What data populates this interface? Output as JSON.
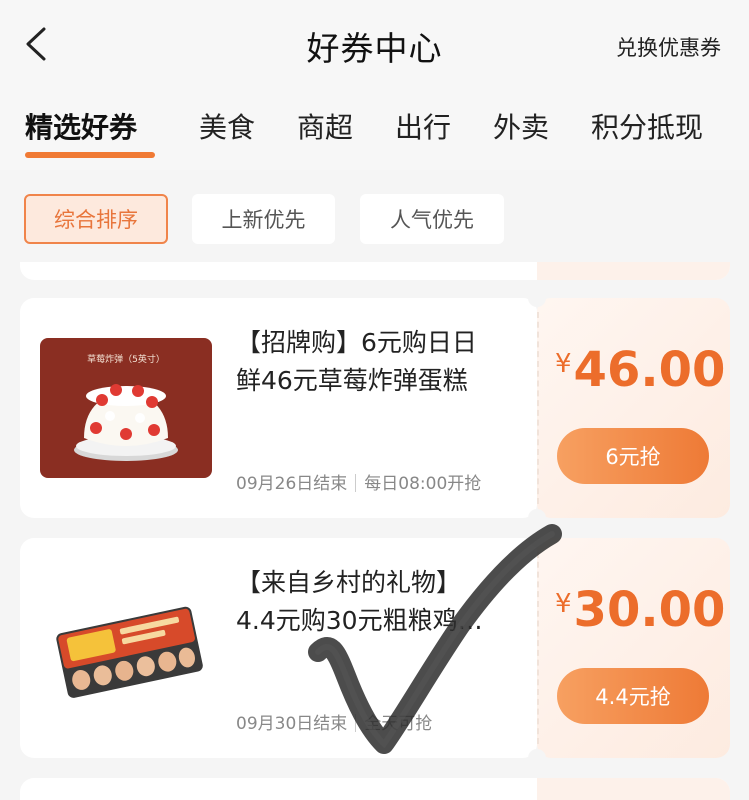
{
  "header": {
    "title": "好券中心",
    "redeem_label": "兑换优惠券"
  },
  "tabs": [
    {
      "label": "精选好券",
      "active": true
    },
    {
      "label": "美食"
    },
    {
      "label": "商超"
    },
    {
      "label": "出行"
    },
    {
      "label": "外卖"
    },
    {
      "label": "积分抵现"
    }
  ],
  "sort": [
    {
      "label": "综合排序",
      "active": true
    },
    {
      "label": "上新优先"
    },
    {
      "label": "人气优先"
    }
  ],
  "coupons": [
    {
      "title_line1": "【招牌购】6元购日日",
      "title_line2": "鲜46元草莓炸弹蛋糕",
      "end_date": "09月26日结束",
      "schedule": "每日08:00开抢",
      "currency": "¥",
      "price": "46.00",
      "button_label": "6元抢",
      "image_caption": "草莓炸弹（5英寸）",
      "image_icon": "strawberry-cake-icon"
    },
    {
      "title_line1": "【来自乡村的礼物】",
      "title_line2": "4.4元购30元粗粮鸡…",
      "end_date": "09月30日结束",
      "schedule": "全天可抢",
      "currency": "¥",
      "price": "30.00",
      "button_label": "4.4元抢",
      "image_icon": "egg-carton-icon"
    }
  ],
  "colors": {
    "accent": "#ec6d2b",
    "button_start": "#f7a061",
    "button_end": "#ee7a36",
    "chip_active_bg": "#fde9dd"
  }
}
